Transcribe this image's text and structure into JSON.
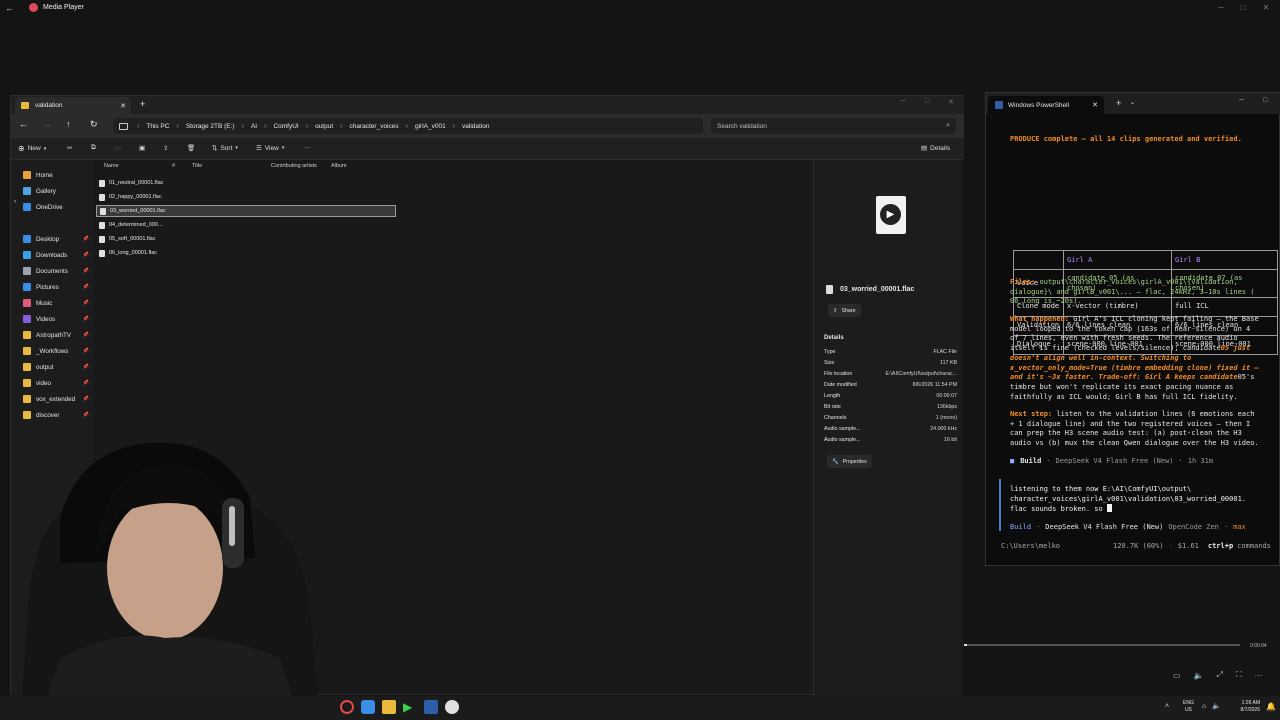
{
  "media_player": {
    "title": "Media Player",
    "time": "0:00:04"
  },
  "explorer": {
    "tab_title": "validation",
    "breadcrumb": [
      "This PC",
      "Storage 2TB (E:)",
      "AI",
      "ComfyUI",
      "output",
      "character_voices",
      "girlA_v001",
      "validation"
    ],
    "search_placeholder": "Search validation",
    "toolbar": {
      "new": "New",
      "sort": "Sort",
      "view": "View",
      "details": "Details"
    },
    "nav": [
      {
        "label": "Home",
        "color": "#e8a23a"
      },
      {
        "label": "Gallery",
        "color": "#4fa3e0"
      },
      {
        "label": "OneDrive",
        "color": "#3a8ee6"
      },
      {
        "label": "Desktop",
        "color": "#3a8ee6",
        "pinned": true
      },
      {
        "label": "Downloads",
        "color": "#3aa0e6",
        "pinned": true
      },
      {
        "label": "Documents",
        "color": "#9aa4b0",
        "pinned": true
      },
      {
        "label": "Pictures",
        "color": "#3a8ee6",
        "pinned": true
      },
      {
        "label": "Music",
        "color": "#e05a7a",
        "pinned": true
      },
      {
        "label": "Videos",
        "color": "#8a5ce0",
        "pinned": true
      },
      {
        "label": "AstropathTV",
        "color": "#e8b93a",
        "pinned": true
      },
      {
        "label": "_Workflows",
        "color": "#e8b93a",
        "pinned": true
      },
      {
        "label": "output",
        "color": "#e8b93a",
        "pinned": true
      },
      {
        "label": "video",
        "color": "#e8b93a",
        "pinned": true
      },
      {
        "label": "vox_extended",
        "color": "#e8b93a",
        "pinned": true
      },
      {
        "label": "discover",
        "color": "#e8b93a",
        "pinned": true
      }
    ],
    "columns": [
      "Name",
      "#",
      "Title",
      "Contributing artists",
      "Album"
    ],
    "files": [
      {
        "name": "01_neutral_00001.flac",
        "selected": false
      },
      {
        "name": "02_happy_00001.flac",
        "selected": false
      },
      {
        "name": "03_worried_00001.flac",
        "selected": true
      },
      {
        "name": "04_determined_000...",
        "selected": false
      },
      {
        "name": "05_soft_00001.flac",
        "selected": false
      },
      {
        "name": "06_long_00001.flac",
        "selected": false
      }
    ],
    "details": {
      "file_name": "03_worried_00001.flac",
      "share": "Share",
      "heading": "Details",
      "rows": [
        {
          "k": "Type",
          "v": "FLAC File"
        },
        {
          "k": "Size",
          "v": "117 KB"
        },
        {
          "k": "File location",
          "v": "E:\\AI\\ComfyUI\\output\\charac..."
        },
        {
          "k": "Date modified",
          "v": "8/6/2026 11:54 PM"
        },
        {
          "k": "Length",
          "v": "00:00:07"
        },
        {
          "k": "Bit rate",
          "v": "136kbps"
        },
        {
          "k": "Channels",
          "v": "1 (mono)"
        },
        {
          "k": "Audio sample...",
          "v": "24.000 kHz"
        },
        {
          "k": "Audio sample...",
          "v": "16 bit"
        }
      ],
      "properties": "Properties"
    }
  },
  "powershell": {
    "tab_title": "Windows PowerShell",
    "produce": "PRODUCE complete — all 14 clips generated and verified.",
    "table": {
      "header": [
        "",
        "Girl A",
        "Girl B"
      ],
      "rows": [
        [
          "Voice",
          "candidate_05 (as\nchosen)",
          "candidate_07 (as\nchosen)"
        ],
        [
          "Clone mode",
          "x-vector (timbre)",
          "full ICL"
        ],
        [
          "Validation",
          "6/6 lines clean",
          "6/6 lines clean"
        ],
        [
          "Dialogue",
          "scene-000 line-001",
          "scene-000 line-001"
        ]
      ]
    },
    "files_label": "Files:",
    "files_text": " output\\character_voices\\girlA_v001\\{validation,\ndialogue}\\ and girlB_v001\\... — flac, 24kHz, 3–10s lines (\n06_long is ~20s).",
    "what_label": "What happened:",
    "what_1": " Girl A's ICL cloning kept failing — the Base\nmodel looped to the token cap (163s of near-silence) on 4\nof 7 lines, even with fresh seeds. The reference audio\nitself is fine (checked levels/silence); candidate",
    "what_2": "05 just\ndoesn't align well in-context. Switching to\nx_vector_only_mode=True (timbre embedding clone) fixed it —\nand it's ~3x faster. Trade-off: Girl A keeps candidate",
    "what_3": "05's\ntimbre but won't replicate its exact pacing nuance as\nfaithfully as ICL would; Girl B has full ICL fidelity.",
    "next_label": "Next step:",
    "next_text": " listen to the validation lines (6 emotions each\n+ 1 dialogue line) and the two registered voices — then I\ncan prep the H3 scene audio test: (a) post-clean the H3\naudio vs (b) mux the clean Qwen dialogue over the H3 video.",
    "build": "Build",
    "model": "DeepSeek V4 Flash Free (New)",
    "elapsed": "1h 31m",
    "input_text": "listening to them now E:\\AI\\ComfyUI\\output\\\ncharacter_voices\\girlA_v001\\validation\\03_worried_00001.\nflac sounds broken. so ",
    "agent": "OpenCode Zen",
    "mode": "max",
    "cwd": "C:\\Users\\melko",
    "tokens": "120.7K (60%)",
    "cost": "$1.61",
    "shortcut": "ctrl+p",
    "shortcut_label": "commands"
  },
  "taskbar": {
    "lang": "ENG",
    "region": "US",
    "time": "1:26 AM",
    "date": "8/7/2026"
  }
}
